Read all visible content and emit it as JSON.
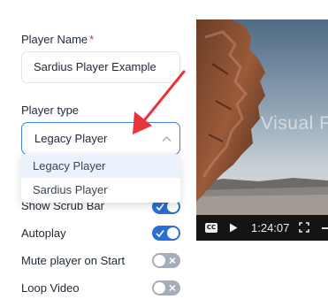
{
  "form": {
    "player_name": {
      "label": "Player Name",
      "required_marker": "*",
      "value": "Sardius Player Example"
    },
    "player_type": {
      "label": "Player type",
      "selected": "Legacy Player",
      "options": [
        "Legacy Player",
        "Sardius Player"
      ]
    },
    "toggles": [
      {
        "label": "Show Scrub Bar",
        "on": true
      },
      {
        "label": "Autoplay",
        "on": true
      },
      {
        "label": "Mute player on Start",
        "on": false
      },
      {
        "label": "Loop Video",
        "on": false
      }
    ]
  },
  "preview": {
    "watermark": "Visual F",
    "controls": {
      "cc_label": "CC",
      "time": "1:24:07"
    }
  },
  "colors": {
    "accent": "#2b6ed1",
    "select_border": "#3d80e6",
    "required": "#d63a3a",
    "toggle_off": "#a4adb9",
    "annotation_arrow": "#e8333a"
  },
  "icons": [
    "chevron-up-icon",
    "check-icon",
    "x-icon",
    "closed-captions-icon",
    "play-icon",
    "fullscreen-icon"
  ]
}
